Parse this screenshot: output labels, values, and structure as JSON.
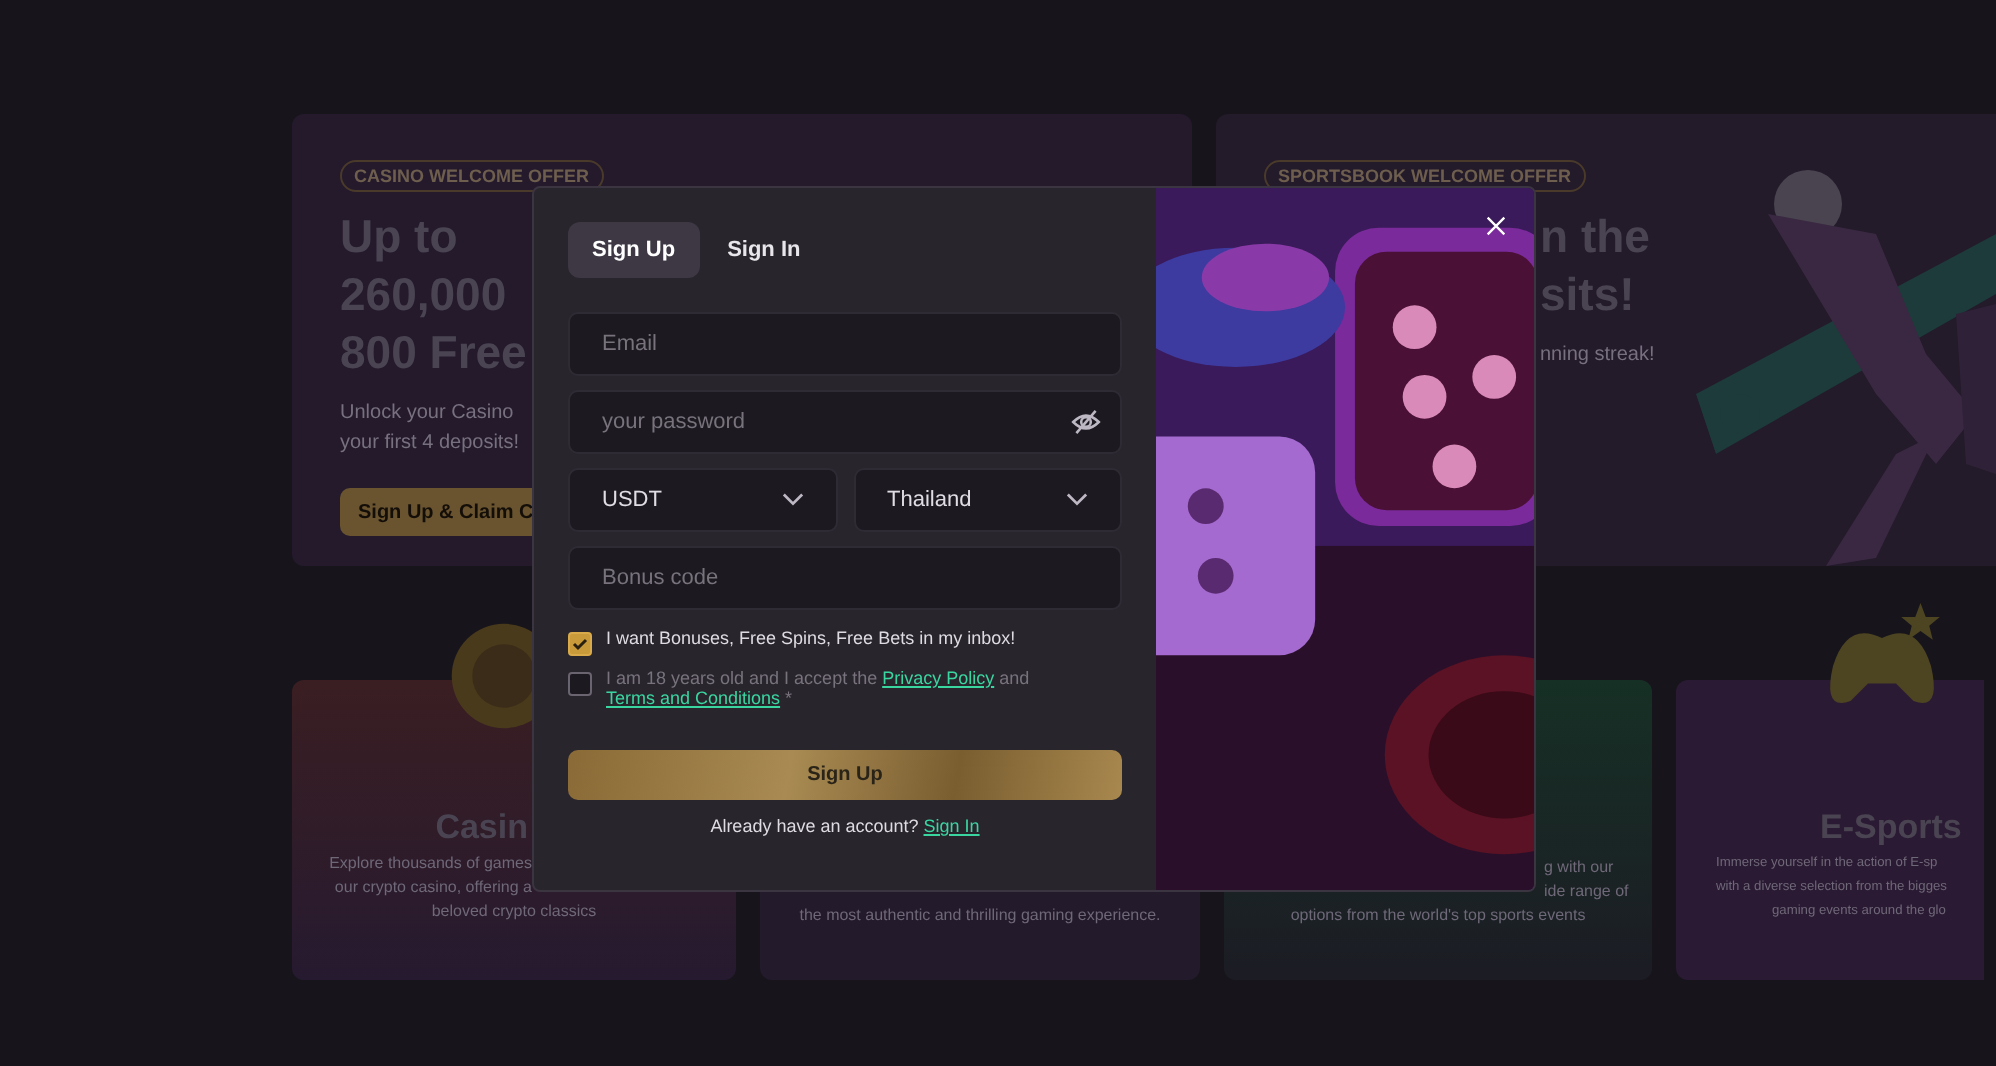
{
  "background": {
    "casino_offer": {
      "badge": "CASINO WELCOME OFFER",
      "headline": [
        "Up to",
        "260,000",
        "800 Free"
      ],
      "description": [
        "Unlock your Casino",
        "your first 4 deposits!"
      ],
      "button": "Sign Up & Claim C"
    },
    "sportsbook_offer": {
      "badge": "SPORTSBOOK WELCOME OFFER",
      "headline": [
        "n the",
        "sits!"
      ],
      "description": "nning streak!"
    },
    "cards": [
      {
        "kind": "casino",
        "title": "Casin",
        "description": [
          "Explore thousands of games",
          "our crypto casino, offering a",
          "beloved crypto classics"
        ]
      },
      {
        "kind": "live",
        "description": [
          "the most authentic and thrilling gaming experience."
        ]
      },
      {
        "kind": "sports",
        "description": [
          "g with our",
          "ide range of",
          "options from the world's top sports events"
        ]
      },
      {
        "kind": "esports",
        "title": "E-Sports",
        "description": [
          "Immerse yourself in the action of E-sp",
          "with a diverse selection from the bigges",
          "gaming events around the glo"
        ]
      }
    ]
  },
  "modal": {
    "tabs": [
      {
        "label": "Sign Up",
        "selected": true
      },
      {
        "label": "Sign In",
        "selected": false
      }
    ],
    "email": {
      "placeholder": "Email"
    },
    "password": {
      "placeholder": "your password"
    },
    "selects": [
      {
        "value": "USDT"
      },
      {
        "value": "Thailand"
      }
    ],
    "bonus_code": {
      "placeholder": "Bonus code"
    },
    "consents": [
      {
        "checked": true,
        "parts": [
          {
            "kind": "text",
            "text": "I want Bonuses, Free Spins, Free Bets in my inbox!"
          }
        ]
      },
      {
        "checked": false,
        "parts": [
          {
            "kind": "text",
            "text": "I am 18 years old and I accept the "
          },
          {
            "kind": "link",
            "text": "Privacy Policy"
          },
          {
            "kind": "text",
            "text": " and "
          },
          {
            "kind": "link",
            "text": "Terms and Conditions"
          },
          {
            "kind": "text",
            "text": " *"
          }
        ]
      }
    ],
    "submit": "Sign Up",
    "footer": {
      "text": "Already have an account? ",
      "link": "Sign In"
    }
  }
}
